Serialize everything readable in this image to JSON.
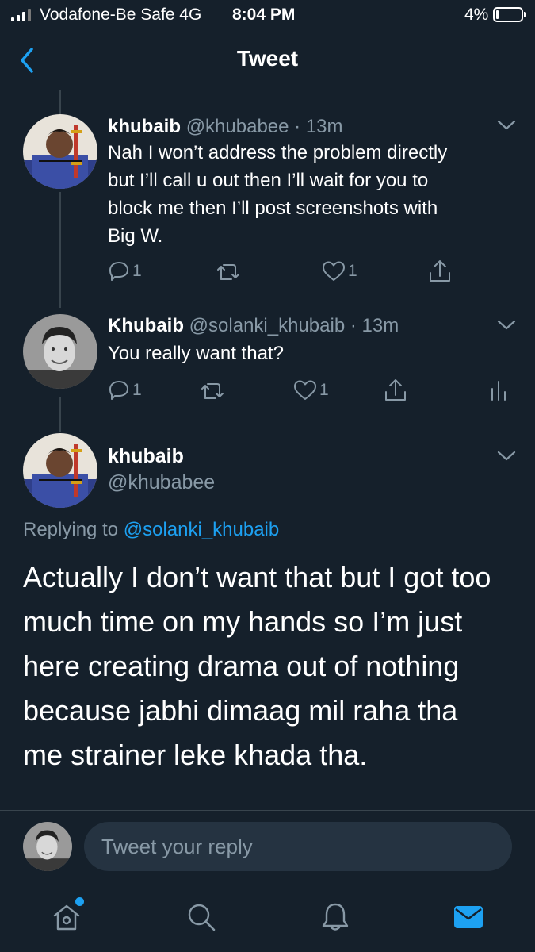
{
  "status_bar": {
    "carrier": "Vodafone-Be Safe  4G",
    "time": "8:04 PM",
    "battery": "4%"
  },
  "header": {
    "title": "Tweet"
  },
  "tweets": [
    {
      "name": "khubaib",
      "handle": "@khubabee",
      "time": "13m",
      "lines": [
        "Nah I won’t address the problem directly",
        "but I’ll call u out then I’ll wait for you to",
        "block me then I’ll post screenshots with",
        "Big W."
      ],
      "replies": "1",
      "likes": "1"
    },
    {
      "name": "Khubaib",
      "handle": "@solanki_khubaib",
      "time": "13m",
      "lines": [
        "You really want that?"
      ],
      "replies": "1",
      "likes": "1"
    }
  ],
  "main_tweet": {
    "name": "khubaib",
    "handle": "@khubabee",
    "replying_label": "Replying to ",
    "replying_to": "@solanki_khubaib",
    "lines": [
      "Actually I don’t want that but I got too",
      "much time on my hands so I’m just",
      "here creating drama out of nothing",
      "because jabhi dimaag mil raha tha",
      "me strainer leke khada tha."
    ]
  },
  "reply_box": {
    "placeholder": "Tweet your reply"
  },
  "tabbar": {
    "items": [
      "home-icon",
      "search-icon",
      "notifications-icon",
      "messages-icon"
    ],
    "active": "messages-icon"
  },
  "colors": {
    "background": "#15202b",
    "accent": "#1da1f2",
    "muted": "#8899a6",
    "divider": "#38444d"
  }
}
